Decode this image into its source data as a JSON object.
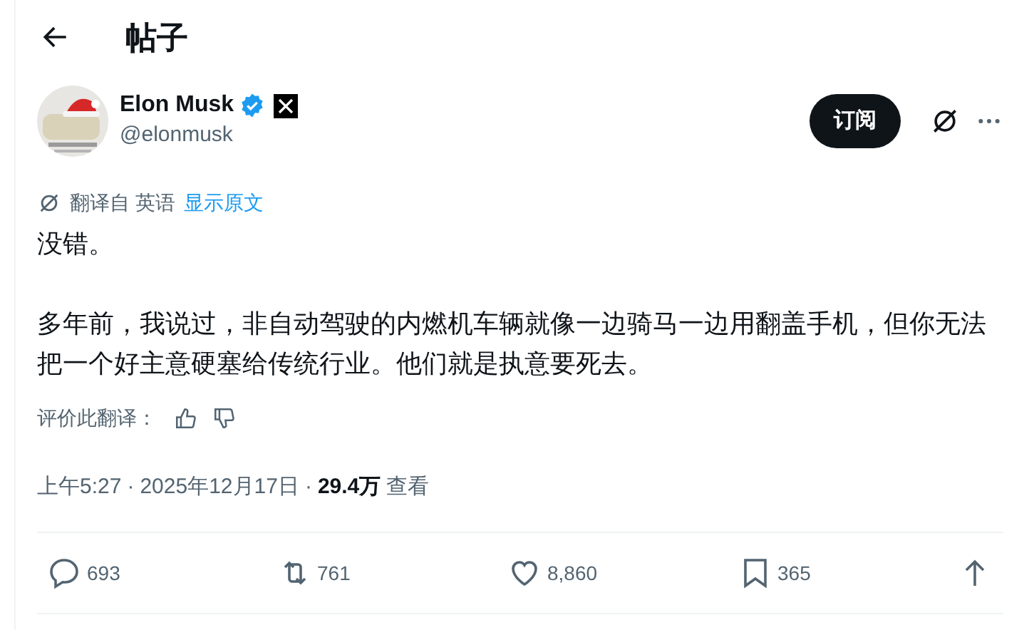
{
  "header": {
    "title": "帖子"
  },
  "author": {
    "name": "Elon Musk",
    "handle": "@elonmusk",
    "verified": true
  },
  "subscribe_button": {
    "label": "订阅"
  },
  "translation": {
    "label": "翻译自 英语",
    "link": "显示原文"
  },
  "body": [
    "没错。",
    "多年前，我说过，非自动驾驶的内燃机车辆就像一边骑马一边用翻盖手机，但你无法把一个好主意硬塞给传统行业。他们就是执意要死去。"
  ],
  "rate_translation": {
    "label": "评价此翻译："
  },
  "meta": {
    "time": "上午5:27",
    "separator_1": "·",
    "date": "2025年12月17日",
    "separator_2": "·",
    "views": "29.4万",
    "views_label": "查看"
  },
  "actions": [
    {
      "kind": "reply",
      "count": "693"
    },
    {
      "kind": "repost",
      "count": "761"
    },
    {
      "kind": "like",
      "count": "8,860"
    },
    {
      "kind": "bookmark",
      "count": "365"
    },
    {
      "kind": "share"
    }
  ]
}
